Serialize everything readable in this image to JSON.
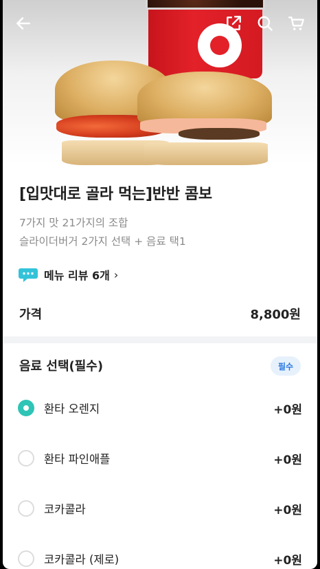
{
  "header": {
    "back_icon": "arrow-left-icon",
    "share_icon": "share-icon",
    "search_icon": "search-icon",
    "cart_icon": "cart-icon"
  },
  "product": {
    "title": "[입맛대로 골라 먹는]반반 콤보",
    "description_1": "7가지 맛 21가지의 조합",
    "description_2": "슬라이더버거 2가지 선택 + 음료 택1",
    "review_label": "메뉴 리뷰 6개",
    "review_arrow": "›",
    "price_label": "가격",
    "price_value": "8,800원"
  },
  "drink_section": {
    "title": "음료 선택(필수)",
    "badge": "필수",
    "options": [
      {
        "label": "환타 오렌지",
        "price": "+0원",
        "selected": true
      },
      {
        "label": "환타 파인애플",
        "price": "+0원",
        "selected": false
      },
      {
        "label": "코카콜라",
        "price": "+0원",
        "selected": false
      },
      {
        "label": "코카콜라 (제로)",
        "price": "+0원",
        "selected": false
      }
    ]
  },
  "colors": {
    "accent": "#2ec4b6",
    "badge_text": "#2a77e0",
    "badge_bg": "#e7f1fc"
  }
}
